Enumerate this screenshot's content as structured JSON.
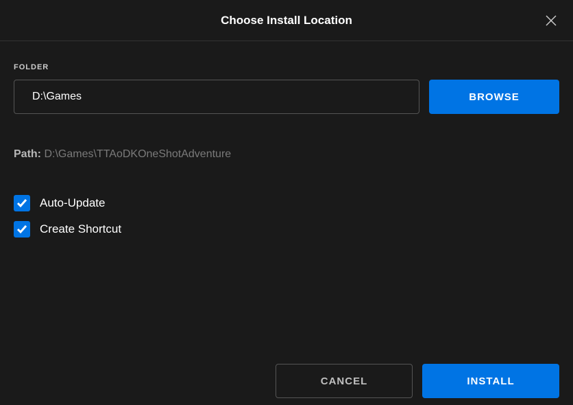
{
  "header": {
    "title": "Choose Install Location"
  },
  "folder": {
    "label": "FOLDER",
    "value": "D:\\Games",
    "browse_label": "BROWSE"
  },
  "path": {
    "label": "Path:",
    "value": "D:\\Games\\TTAoDKOneShotAdventure"
  },
  "options": {
    "auto_update": {
      "label": "Auto-Update",
      "checked": true
    },
    "create_shortcut": {
      "label": "Create Shortcut",
      "checked": true
    }
  },
  "footer": {
    "cancel_label": "CANCEL",
    "install_label": "INSTALL"
  }
}
